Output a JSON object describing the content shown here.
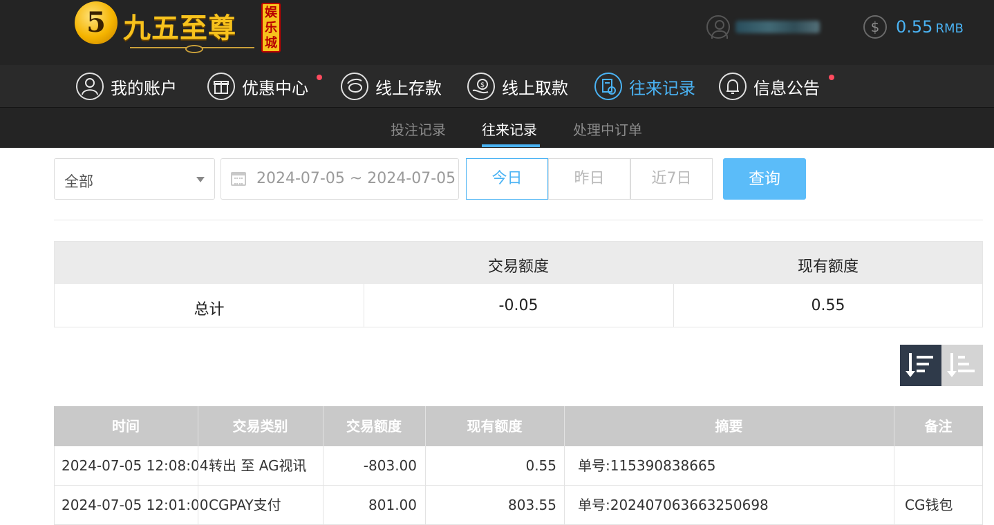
{
  "header": {
    "logo_text": "九五至尊",
    "logo_badge": "娱乐城",
    "logo_mark": "5",
    "balance_value": "0.55",
    "balance_unit": "RMB"
  },
  "nav": {
    "items": [
      {
        "label": "我的账户",
        "icon": "user-icon"
      },
      {
        "label": "优惠中心",
        "icon": "gift-icon"
      },
      {
        "label": "线上存款",
        "icon": "deposit-icon"
      },
      {
        "label": "线上取款",
        "icon": "withdraw-icon"
      },
      {
        "label": "往来记录",
        "icon": "records-icon",
        "active": true
      },
      {
        "label": "信息公告",
        "icon": "bell-icon"
      }
    ]
  },
  "subnav": {
    "tabs": [
      "投注记录",
      "往来记录",
      "处理中订单"
    ],
    "active": "往来记录"
  },
  "filter": {
    "type_value": "全部",
    "date_range": "2024-07-05 ~ 2024-07-05",
    "quick": [
      "今日",
      "昨日",
      "近7日"
    ],
    "quick_active": "今日",
    "query_label": "查询"
  },
  "summary": {
    "headers": [
      "",
      "交易额度",
      "现有额度"
    ],
    "row_label": "总计",
    "trade_amount": "-0.05",
    "current_amount": "0.55"
  },
  "records": {
    "headers": [
      "时间",
      "交易类别",
      "交易额度",
      "现有额度",
      "摘要",
      "备注"
    ],
    "rows": [
      [
        "2024-07-05 12:08:04",
        "转出 至 AG视讯",
        "-803.00",
        "0.55",
        "单号:115390838665",
        ""
      ],
      [
        "2024-07-05 12:01:00",
        "CGPAY支付",
        "801.00",
        "803.55",
        "单号:202407063663250698",
        "CG钱包"
      ]
    ]
  },
  "colors": {
    "accent": "#4ab3f4",
    "header_bg": "#242424",
    "red_dot": "#ff4b5f"
  }
}
